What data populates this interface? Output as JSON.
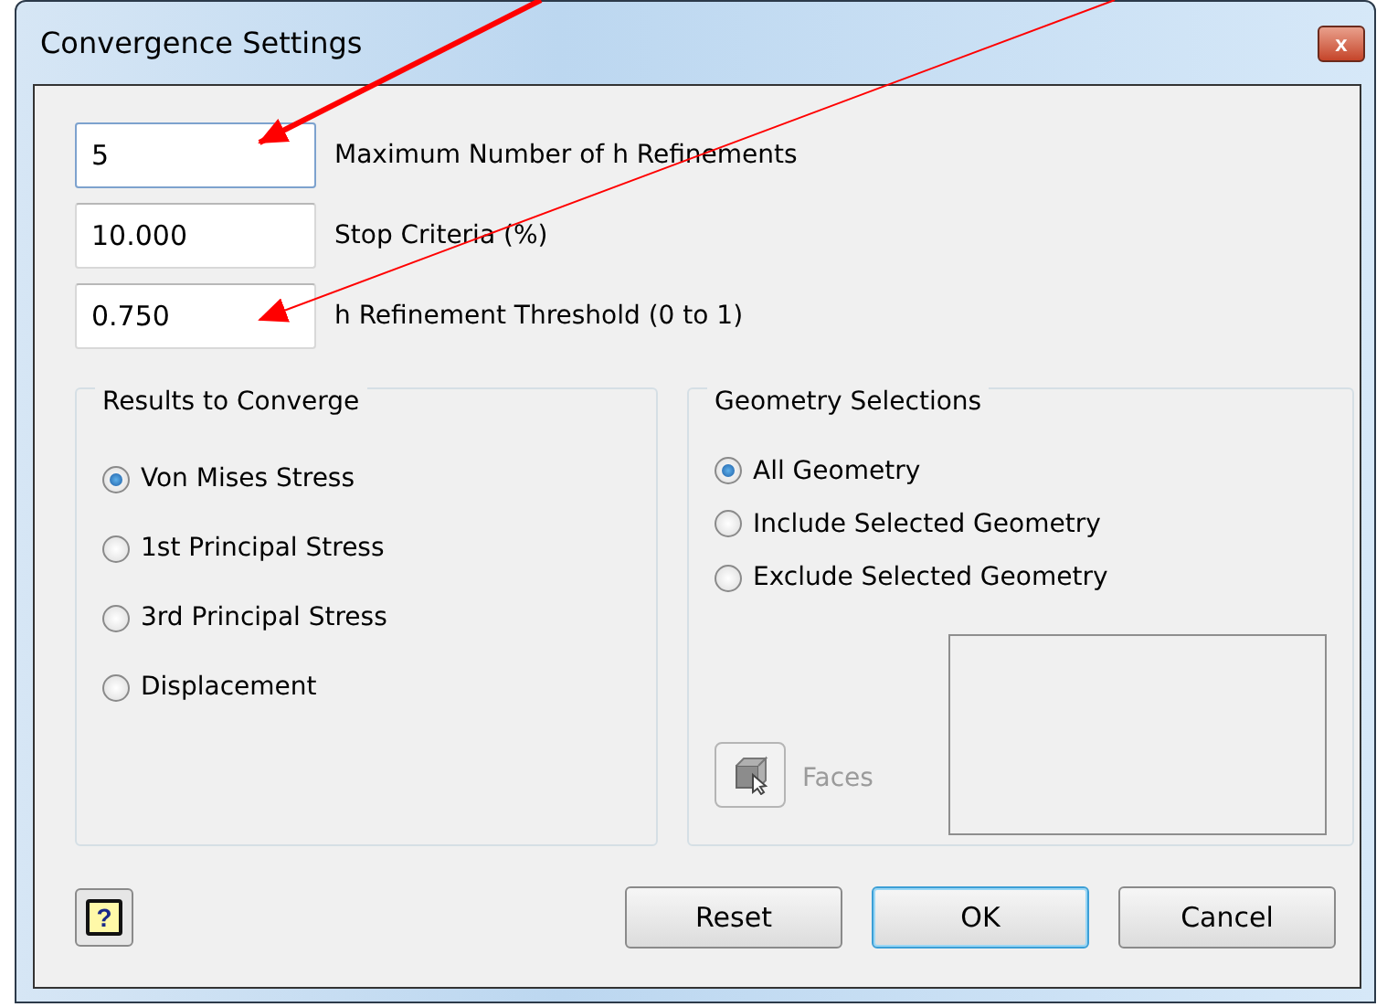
{
  "window": {
    "title": "Convergence Settings",
    "close": "x"
  },
  "fields": [
    {
      "value": "5",
      "label": "Maximum Number of h Refinements",
      "focused": true
    },
    {
      "value": "10.000",
      "label": "Stop Criteria (%)",
      "focused": false
    },
    {
      "value": "0.750",
      "label": "h Refinement Threshold (0 to 1)",
      "focused": false
    }
  ],
  "results_group": {
    "title": "Results to Converge",
    "options": [
      {
        "label": "Von Mises Stress",
        "selected": true
      },
      {
        "label": "1st Principal Stress",
        "selected": false
      },
      {
        "label": "3rd Principal Stress",
        "selected": false
      },
      {
        "label": "Displacement",
        "selected": false
      }
    ]
  },
  "geometry_group": {
    "title": "Geometry Selections",
    "options": [
      {
        "label": "All Geometry",
        "selected": true
      },
      {
        "label": "Include Selected Geometry",
        "selected": false
      },
      {
        "label": "Exclude Selected Geometry",
        "selected": false
      }
    ],
    "faces": {
      "label": "Faces",
      "disabled": true
    }
  },
  "help": {
    "label": "?"
  },
  "buttons": [
    {
      "label": "Reset",
      "default": false
    },
    {
      "label": "OK",
      "default": true
    },
    {
      "label": "Cancel",
      "default": false
    }
  ]
}
